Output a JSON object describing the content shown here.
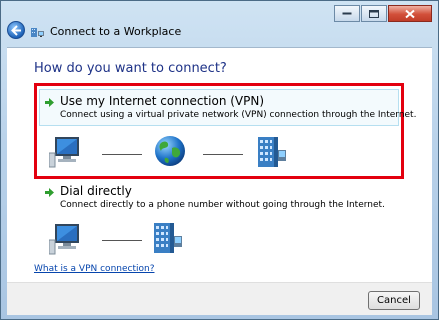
{
  "window": {
    "title": "Connect to a Workplace"
  },
  "main": {
    "heading": "How do you want to connect?",
    "options": [
      {
        "title": "Use my Internet connection (VPN)",
        "description": "Connect using a virtual private network (VPN) connection through the Internet."
      },
      {
        "title": "Dial directly",
        "description": "Connect directly to a phone number without going through the Internet."
      }
    ],
    "help_link": "What is a VPN connection?"
  },
  "footer": {
    "cancel_label": "Cancel"
  },
  "icons": {
    "back": "back-arrow-icon",
    "app": "workplace-network-icon",
    "option_arrow": "green-arrow-icon",
    "computer": "computer-icon",
    "internet": "globe-icon",
    "server": "workplace-server-icon"
  },
  "colors": {
    "heading": "#1e3287",
    "highlight_border": "#e3000f",
    "option_background": "#f3fafd",
    "link": "#0645ad"
  }
}
